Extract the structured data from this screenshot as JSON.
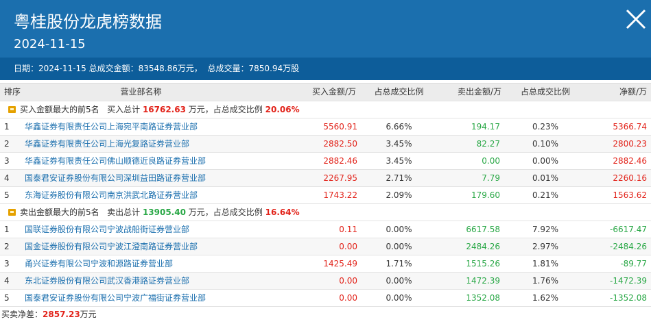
{
  "header": {
    "title": "粤桂股份龙虎榜数据",
    "date": "2024-11-15",
    "summary_date_label": "日期：",
    "summary_date": "2024-11-15",
    "summary_amount_label": "总成交金额：",
    "summary_amount": "83548.86万元，",
    "summary_volume_label": "总成交量：",
    "summary_volume": "7850.94万股"
  },
  "columns": [
    "排序",
    "营业部名称",
    "买入金额/万",
    "占总成交比例",
    "卖出金额/万",
    "占总成交比例",
    "净额/万"
  ],
  "buy_group": {
    "label": "买入金额最大的前5名",
    "total_label": "买入总计",
    "total": "16762.63",
    "total_unit": "万元，占总成交比例",
    "ratio": "20.06%",
    "rows": [
      [
        "1",
        "华鑫证券有限责任公司上海宛平南路证券营业部",
        "5560.91",
        "6.66%",
        "194.17",
        "0.23%",
        "5366.74"
      ],
      [
        "2",
        "华鑫证券有限责任公司上海光复路证券营业部",
        "2882.50",
        "3.45%",
        "82.27",
        "0.10%",
        "2800.23"
      ],
      [
        "3",
        "华鑫证券有限责任公司佛山顺德近良路证券营业部",
        "2882.46",
        "3.45%",
        "0.00",
        "0.00%",
        "2882.46"
      ],
      [
        "4",
        "国泰君安证券股份有限公司深圳益田路证券营业部",
        "2267.95",
        "2.71%",
        "7.79",
        "0.01%",
        "2260.16"
      ],
      [
        "5",
        "东海证券股份有限公司南京洪武北路证券营业部",
        "1743.22",
        "2.09%",
        "179.60",
        "0.21%",
        "1563.62"
      ]
    ]
  },
  "sell_group": {
    "label": "卖出金额最大的前5名",
    "total_label": "卖出总计",
    "total": "13905.40",
    "total_unit": "万元，占总成交比例",
    "ratio": "16.64%",
    "rows": [
      [
        "1",
        "国联证券股份有限公司宁波战船街证券营业部",
        "0.11",
        "0.00%",
        "6617.58",
        "7.92%",
        "-6617.47"
      ],
      [
        "2",
        "国金证券股份有限公司宁波江澄南路证券营业部",
        "0.00",
        "0.00%",
        "2484.26",
        "2.97%",
        "-2484.26"
      ],
      [
        "3",
        "甬兴证券有限公司宁波和源路证券营业部",
        "1425.49",
        "1.71%",
        "1515.26",
        "1.81%",
        "-89.77"
      ],
      [
        "4",
        "东北证券股份有限公司武汉香港路证券营业部",
        "0.00",
        "0.00%",
        "1472.39",
        "1.76%",
        "-1472.39"
      ],
      [
        "5",
        "国泰君安证券股份有限公司宁波广福街证券营业部",
        "0.00",
        "0.00%",
        "1352.08",
        "1.62%",
        "-1352.08"
      ]
    ]
  },
  "footer": {
    "label": "买卖净差：",
    "value": "2857.23",
    "unit": "万元"
  },
  "colors": {
    "header_bg": "#1b6fae",
    "summary_bg": "#0d5d9a",
    "buy": "#e2231a",
    "sell": "#28a745",
    "link": "#1b6fae"
  },
  "icons": {
    "close": "close-icon",
    "group": "folder-icon"
  }
}
